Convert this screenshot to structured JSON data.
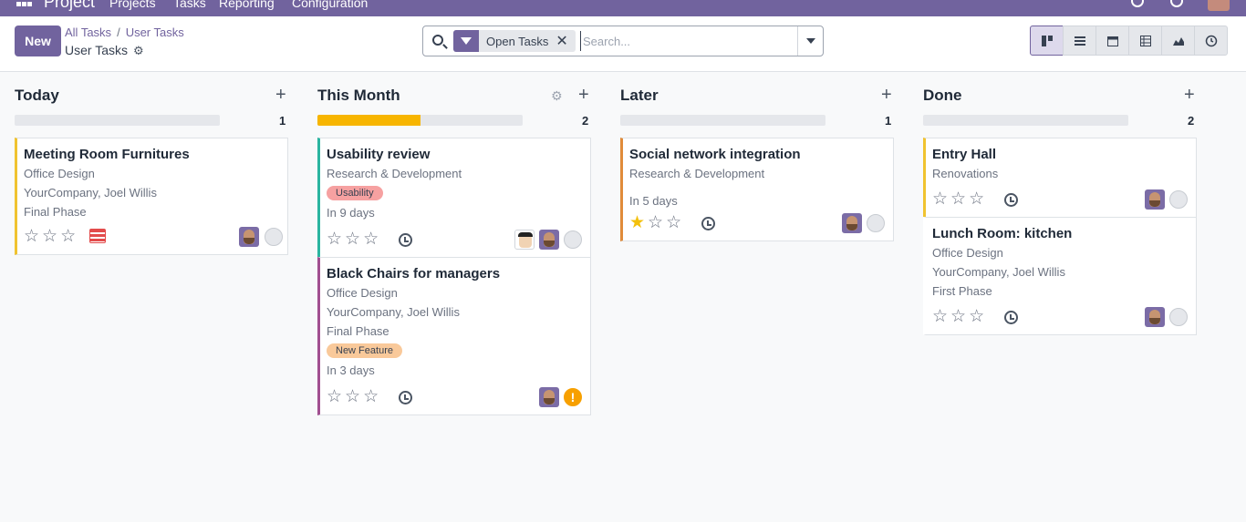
{
  "topbar": {
    "brand": "Project",
    "menu": [
      "Projects",
      "Tasks",
      "Reporting",
      "Configuration"
    ]
  },
  "control": {
    "new_label": "New",
    "breadcrumb": [
      "All Tasks",
      "User Tasks"
    ],
    "subtitle": "User Tasks",
    "facet_label": "Open Tasks",
    "search_placeholder": "Search...",
    "views": [
      "kanban-icon",
      "list-icon",
      "calendar-icon",
      "pivot-icon",
      "graph-icon",
      "activity-icon"
    ]
  },
  "columns": [
    {
      "title": "Today",
      "count": "1",
      "progress": 0,
      "cards": [
        {
          "title": "Meeting Room Furnitures",
          "project": "Office Design",
          "customer": "YourCompany, Joel Willis",
          "stage": "Final Phase",
          "border": "#f0c330",
          "stars": 0
        }
      ]
    },
    {
      "title": "This Month",
      "count": "2",
      "progress": 0.5,
      "cards": [
        {
          "title": "Usability review",
          "project": "Research & Development",
          "tag": "Usability",
          "tag_color": "#f6a1a1",
          "deadline": "In 9 days",
          "border": "#2ab5a0",
          "stars": 0
        },
        {
          "title": "Black Chairs for managers",
          "project": "Office Design",
          "customer": "YourCompany, Joel Willis",
          "stage": "Final Phase",
          "tag": "New Feature",
          "tag_color": "#f9c99a",
          "deadline": "In 3 days",
          "border": "#a14f90",
          "stars": 0
        }
      ]
    },
    {
      "title": "Later",
      "count": "1",
      "progress": 0,
      "cards": [
        {
          "title": "Social network integration",
          "project": "Research & Development",
          "deadline": "In 5 days",
          "border": "#e08b3a",
          "stars": 1
        }
      ]
    },
    {
      "title": "Done",
      "count": "2",
      "progress": 0,
      "cards": [
        {
          "title": "Entry Hall",
          "project": "Renovations",
          "border": "#f0c330",
          "stars": 0
        },
        {
          "title": "Lunch Room: kitchen",
          "project": "Office Design",
          "customer": "YourCompany, Joel Willis",
          "stage": "First Phase",
          "border": "#ffffff",
          "stars": 0
        }
      ]
    }
  ]
}
